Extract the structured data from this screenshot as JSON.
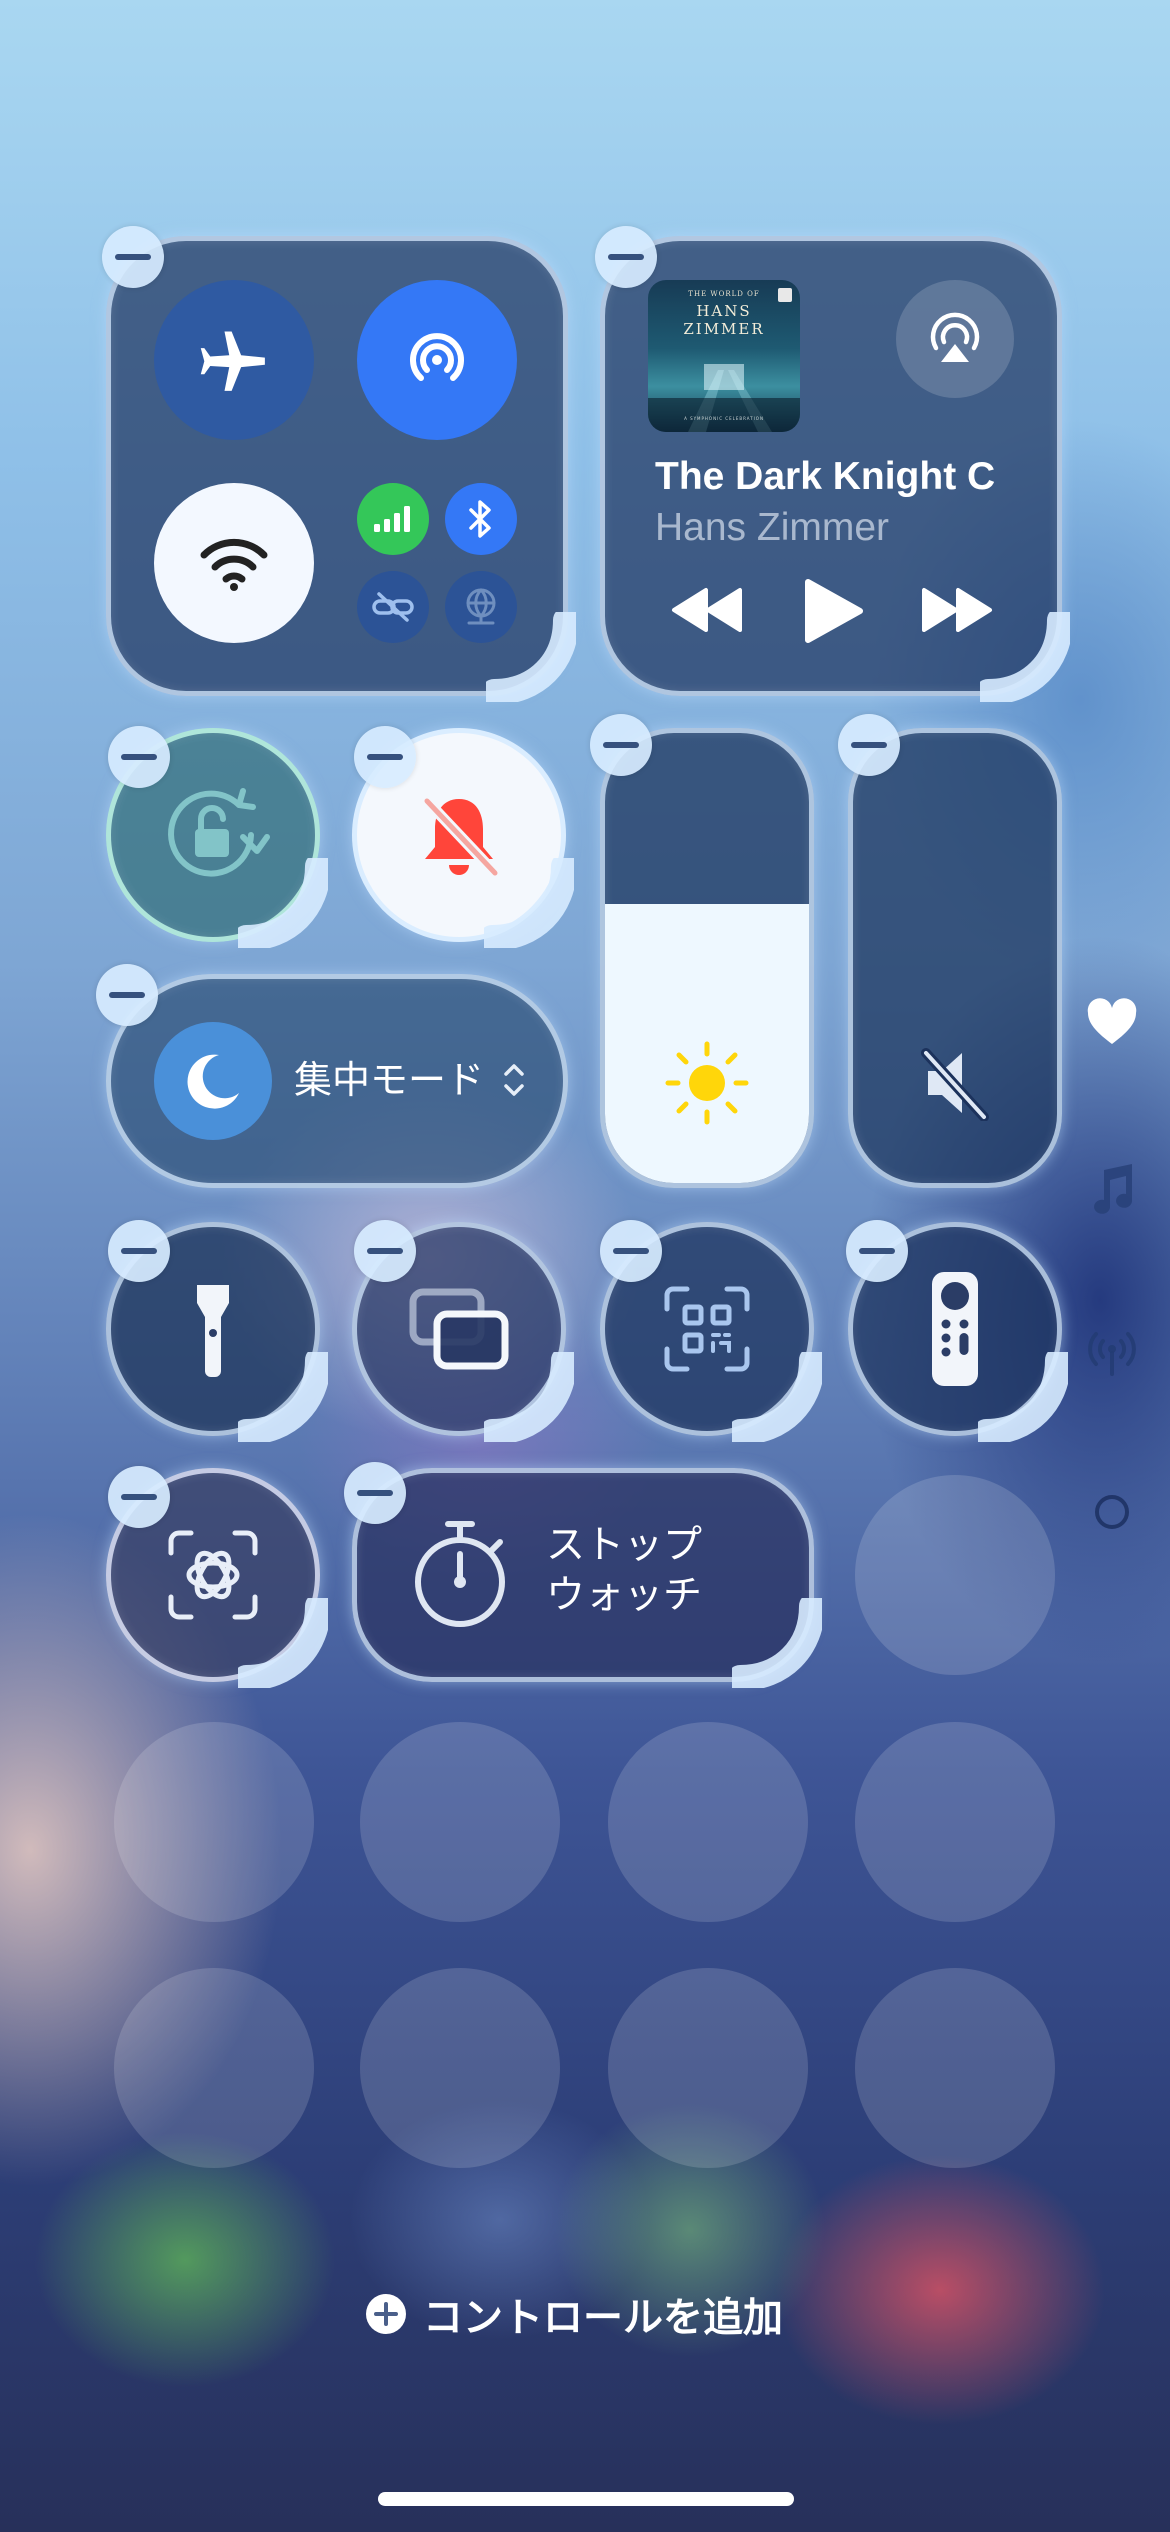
{
  "connectivity": {
    "airplane_icon": "airplane-icon",
    "airdrop_icon": "airdrop-icon",
    "wifi_icon": "wifi-icon",
    "cellular_icon": "cellular-icon",
    "bluetooth_icon": "bluetooth-icon",
    "hotspot_icon": "hotspot-icon",
    "vpn_icon": "vpn-icon"
  },
  "now_playing": {
    "album_art_lines": [
      "THE WORLD OF",
      "HANS",
      "ZIMMER",
      "A SYMPHONIC CELEBRATION"
    ],
    "title": "The Dark Knight C",
    "artist": "Hans Zimmer"
  },
  "focus": {
    "label": "集中モード"
  },
  "brightness": {
    "level": 0.62
  },
  "volume": {
    "level": 0.0
  },
  "stopwatch": {
    "line1": "ストップ",
    "line2": "ウォッチ"
  },
  "add_control": {
    "label": "コントロールを追加"
  },
  "colors": {
    "accent_blue": "#3478f6",
    "cellular_green": "#34c759",
    "mute_red": "#ff453a",
    "sun_yellow": "#ffd60a"
  },
  "page_indicators": [
    "heart-icon",
    "music-note-icon",
    "broadcast-icon",
    "circle-icon"
  ]
}
